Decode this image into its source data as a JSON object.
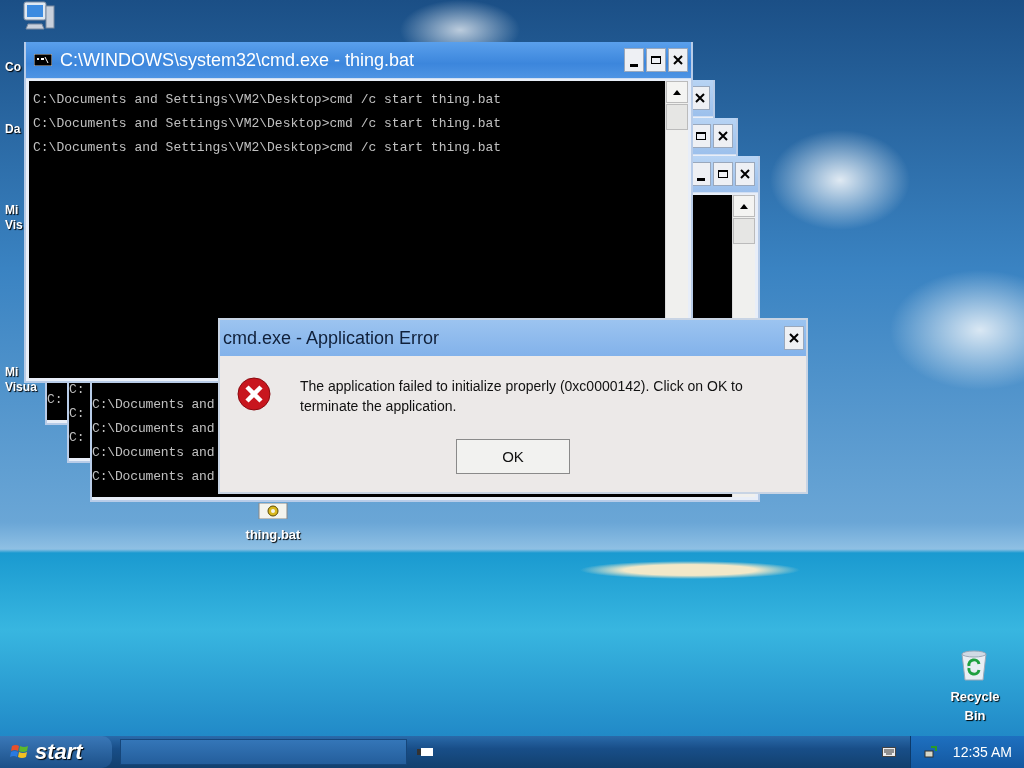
{
  "desktop": {
    "partial_labels": [
      [
        "Co"
      ],
      [
        "Da"
      ],
      [
        "Mi",
        "Vis"
      ],
      [
        "Mi",
        "Visua"
      ]
    ],
    "icons": [
      {
        "kind": "computer"
      },
      {
        "kind": "batch-file",
        "lines": [
          "thing.bat"
        ]
      },
      {
        "kind": "recycle-bin",
        "lines": [
          "Recycle",
          "Bin"
        ]
      }
    ]
  },
  "background_windows": [
    {
      "lines": [
        "C:"
      ]
    },
    {
      "lines": [
        "C:",
        "C:",
        "C:"
      ]
    },
    {
      "lines": [
        "C:\\Documents and",
        "C:\\Documents and",
        "C:\\Documents and",
        "C:\\Documents and"
      ]
    }
  ],
  "console_window": {
    "title": "C:\\WINDOWS\\system32\\cmd.exe - thing.bat",
    "lines": [
      "C:\\Documents and Settings\\VM2\\Desktop>cmd /c start thing.bat",
      "C:\\Documents and Settings\\VM2\\Desktop>cmd /c start thing.bat",
      "C:\\Documents and Settings\\VM2\\Desktop>cmd /c start thing.bat"
    ]
  },
  "error_dialog": {
    "title": "cmd.exe - Application Error",
    "message": "The application failed to initialize properly (0xc0000142). Click on OK to terminate the application.",
    "button": "OK"
  },
  "taskbar": {
    "start": "start",
    "clock": "12:35 AM"
  }
}
